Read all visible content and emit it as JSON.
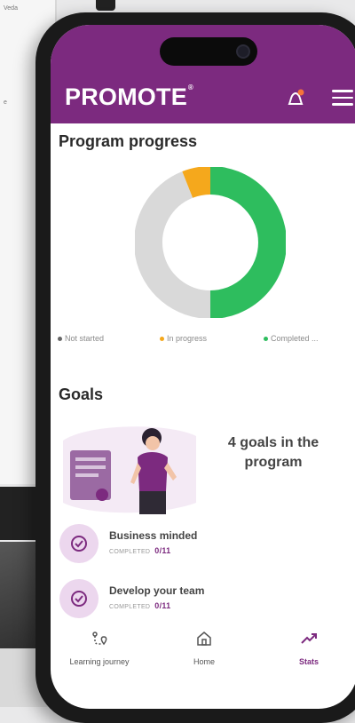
{
  "background": {
    "screen_snippets": [
      "Veda",
      "e"
    ]
  },
  "app": {
    "logo": "PROMOTE",
    "logo_mark": "®",
    "notifications_icon": "notification-icon",
    "menu_icon": "hamburger-menu-icon",
    "brand_color": "#7c2a7f"
  },
  "progress": {
    "title": "Program progress",
    "legend": [
      {
        "label": "Not started",
        "color": "#d9d9d9"
      },
      {
        "label": "In progress",
        "color": "#f5a81c"
      },
      {
        "label": "Completed ...",
        "color": "#2ebd5e"
      }
    ]
  },
  "chart_data": {
    "type": "pie",
    "title": "",
    "categories": [
      "Not started",
      "In progress",
      "Completed ..."
    ],
    "values": [
      44,
      6,
      50
    ],
    "colors": [
      "#d9d9d9",
      "#f5a81c",
      "#2ebd5e"
    ],
    "donut": true,
    "legend": "bottom"
  },
  "goals": {
    "title": "Goals",
    "count_text": "4 goals in the program",
    "items": [
      {
        "name": "Business minded",
        "status_label": "COMPLETED",
        "status_value": "0/11"
      },
      {
        "name": "Develop your team",
        "status_label": "COMPLETED",
        "status_value": "0/11"
      }
    ]
  },
  "nav": {
    "items": [
      {
        "label": "Learning journey",
        "icon": "route-map-icon"
      },
      {
        "label": "Home",
        "icon": "home-icon"
      },
      {
        "label": "Stats",
        "icon": "trending-up-icon",
        "active": true
      }
    ]
  }
}
